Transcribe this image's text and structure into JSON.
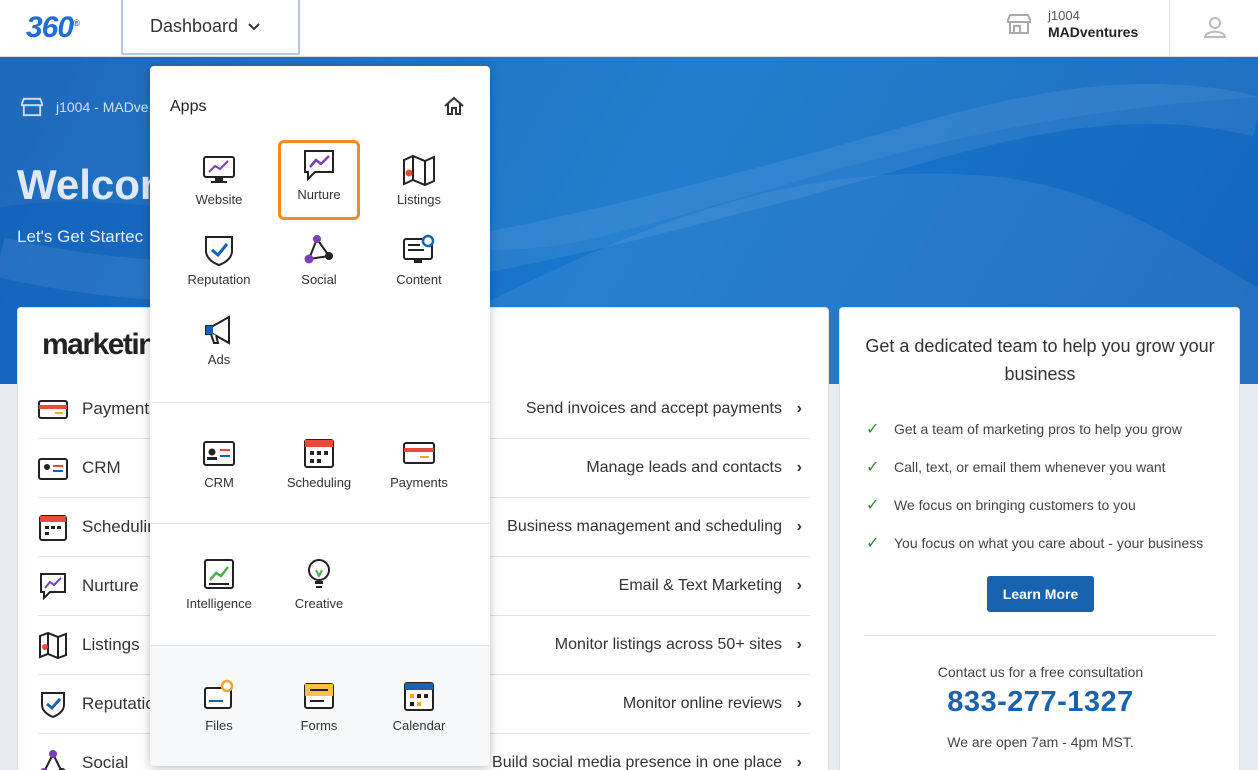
{
  "topbar": {
    "logo": "360",
    "logo_mark": "®",
    "dashboard_label": "Dashboard",
    "account_id": "j1004",
    "account_name": "MADventures"
  },
  "hero": {
    "breadcrumb": "j1004 - MADve",
    "welcome": "Welcon",
    "subtitle": "Let's Get Startec"
  },
  "main_card": {
    "brand": "marketin",
    "rows": [
      {
        "name": "Payments",
        "desc": "Send invoices and accept payments"
      },
      {
        "name": "CRM",
        "desc": "Manage leads and contacts"
      },
      {
        "name": "Schedulin",
        "desc": "Business management and scheduling"
      },
      {
        "name": "Nurture",
        "desc": "Email & Text Marketing"
      },
      {
        "name": "Listings",
        "desc": "Monitor listings across 50+ sites"
      },
      {
        "name": "Reputatio",
        "desc": "Monitor online reviews"
      },
      {
        "name": "Social",
        "desc": "Build social media presence in one place"
      }
    ]
  },
  "side_card": {
    "title": "Get a dedicated team to help you grow your business",
    "checks": [
      "Get a team of marketing pros to help you grow",
      "Call, text, or email them whenever you want",
      "We focus on bringing customers to you",
      "You focus on what you care about - your business"
    ],
    "learn_more": "Learn More",
    "contact": "Contact us for a free consultation",
    "phone": "833-277-1327",
    "hours": "We are open 7am - 4pm MST."
  },
  "menu": {
    "title": "Apps",
    "apps": [
      "Website",
      "Nurture",
      "Listings",
      "Reputation",
      "Social",
      "Content",
      "Ads"
    ],
    "tools": [
      "CRM",
      "Scheduling",
      "Payments"
    ],
    "insights": [
      "Intelligence",
      "Creative"
    ],
    "files": [
      "Files",
      "Forms",
      "Calendar"
    ],
    "selected": "Nurture"
  },
  "colors": {
    "brand_blue": "#1763b0",
    "selection_orange": "#f28a26",
    "check_green": "#2e8b3a"
  }
}
